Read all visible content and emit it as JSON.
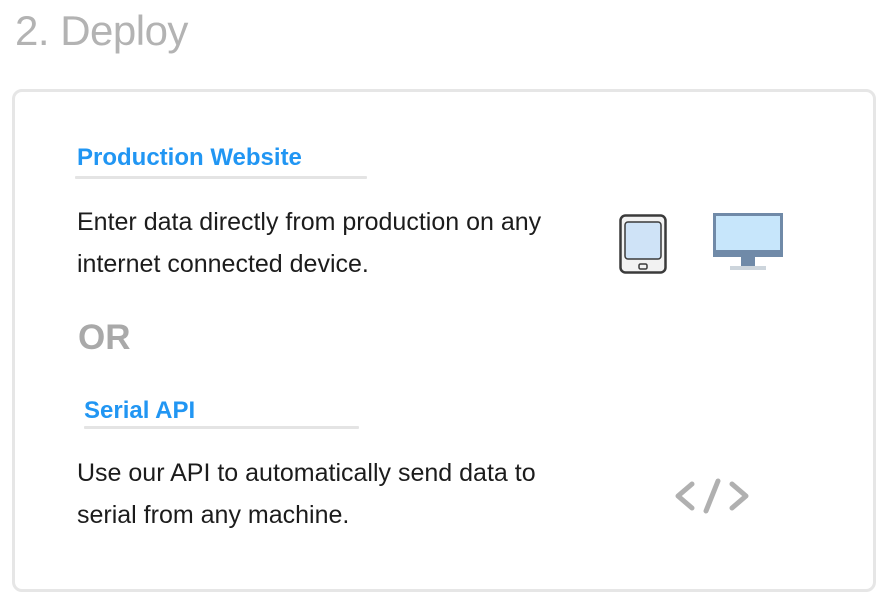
{
  "page": {
    "title": "2. Deploy"
  },
  "options": {
    "production": {
      "heading": "Production Website",
      "description": "Enter data directly from production on any internet connected device.",
      "icons": [
        "tablet-icon",
        "desktop-monitor-icon"
      ]
    },
    "separator": "OR",
    "api": {
      "heading": "Serial API",
      "description": "Use our API to automatically send data to serial from any machine.",
      "icons": [
        "code-brackets-icon"
      ]
    }
  },
  "colors": {
    "accent": "#2196f3",
    "title_gray": "#b3b3b3",
    "or_gray": "#a9a9a9",
    "border": "#e6e6e6",
    "text": "#1c1c1c"
  }
}
